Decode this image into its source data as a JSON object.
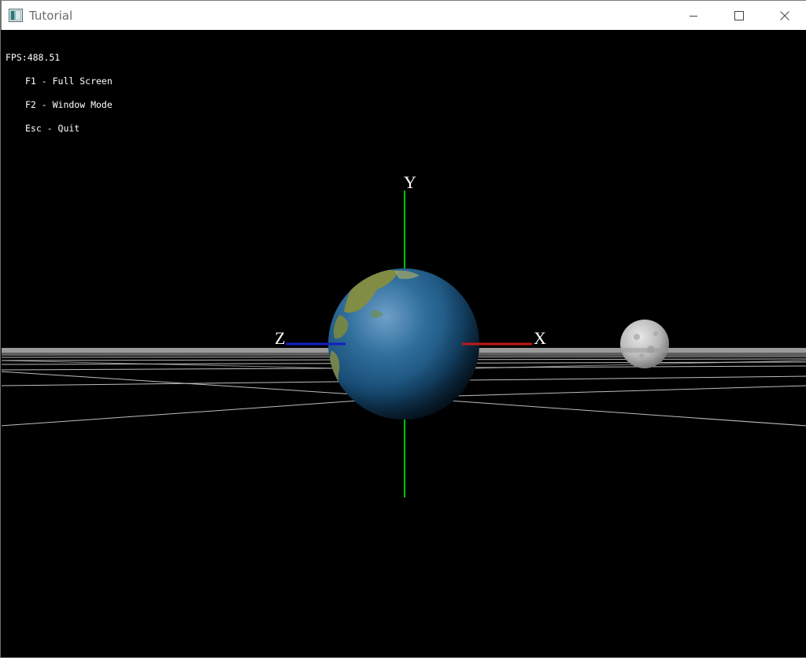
{
  "window": {
    "title": "Tutorial",
    "app_icon": "window-app-icon",
    "controls": {
      "minimize_icon": "minimize-icon",
      "maximize_icon": "maximize-icon",
      "close_icon": "close-icon"
    }
  },
  "hud": {
    "fps": "FPS:488.51",
    "help": [
      "F1 - Full Screen",
      "F2 - Window Mode",
      "Esc - Quit"
    ]
  },
  "axes": {
    "x_label": "X",
    "y_label": "Y",
    "z_label": "Z",
    "x_color": "#c01818",
    "y_color": "#00c000",
    "z_color": "#1020c0"
  },
  "scene": {
    "background": "#000000",
    "grid_color": "#bdbdbd",
    "earth": "earth-sphere",
    "moon": "moon-sphere"
  }
}
